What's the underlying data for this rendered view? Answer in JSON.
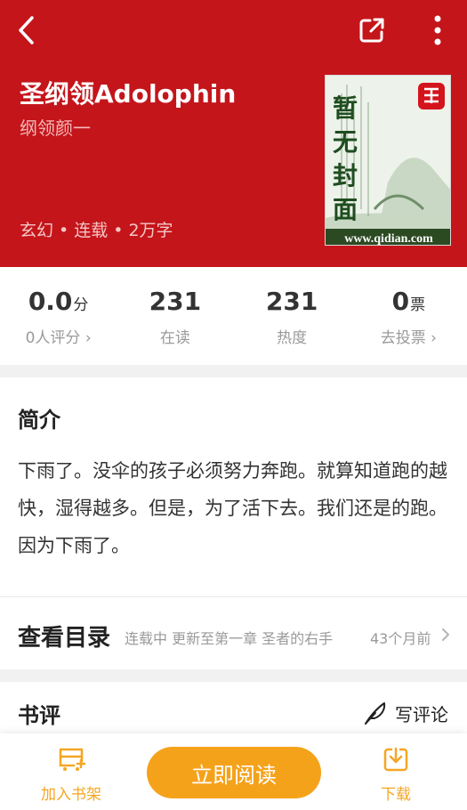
{
  "header": {
    "title": "圣纲领Adolophin",
    "author": "纲领颜一",
    "meta": [
      "玄幻",
      "连载",
      "2万字"
    ],
    "bg_color": "#c4151b"
  },
  "cover": {
    "caption": "暂无封面",
    "site": "www.qidian.com"
  },
  "stats": [
    {
      "value": "0.0",
      "unit": "分",
      "label": "0人评分 ›"
    },
    {
      "value": "231",
      "unit": "",
      "label": "在读"
    },
    {
      "value": "231",
      "unit": "",
      "label": "热度"
    },
    {
      "value": "0",
      "unit": "票",
      "label": "去投票 ›"
    }
  ],
  "intro": {
    "title": "简介",
    "text": "下雨了。没伞的孩子必须努力奔跑。就算知道跑的越快，湿得越多。但是，为了活下去。我们还是的跑。因为下雨了。"
  },
  "toc": {
    "title": "查看目录",
    "status": "连载中 更新至第一章 圣者的右手",
    "time": "43个月前"
  },
  "reviews": {
    "title": "书评",
    "write_label": "写评论"
  },
  "bottom_bar": {
    "add_shelf_label": "加入书架",
    "read_label": "立即阅读",
    "download_label": "下载",
    "accent_color": "#f5a21b"
  },
  "icons": [
    "back-icon",
    "share-icon",
    "more-icon",
    "feather-pen-icon",
    "bookshelf-icon",
    "download-icon",
    "chevron-right-icon"
  ]
}
